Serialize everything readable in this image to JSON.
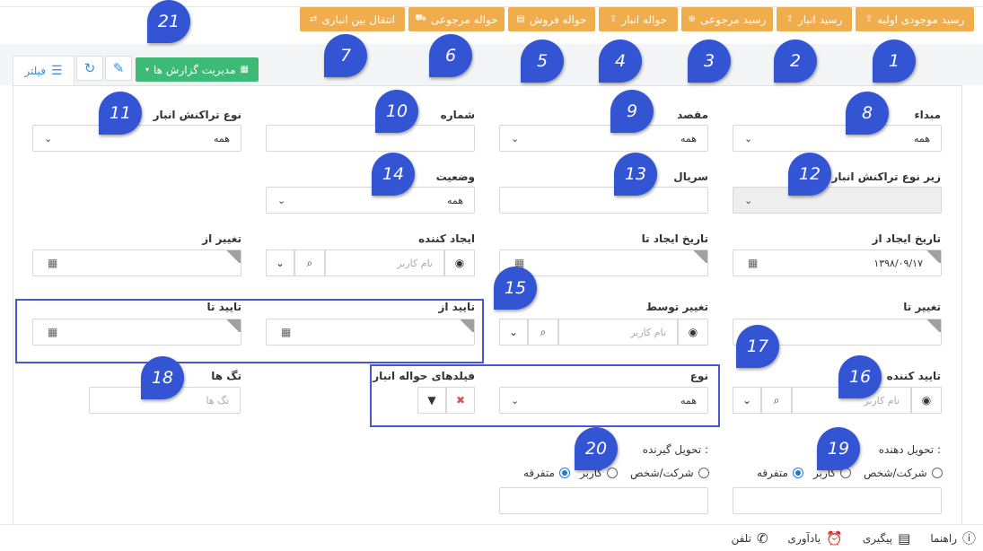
{
  "top_buttons": [
    {
      "label": "رسید موجودی اولیه",
      "icon": "receipt-icon"
    },
    {
      "label": "رسید انبار",
      "icon": "receipt-icon"
    },
    {
      "label": "رسید مرجوعی",
      "icon": "return-icon"
    },
    {
      "label": "حواله انبار",
      "icon": "transfer-icon"
    },
    {
      "label": "حواله فروش",
      "icon": "sale-icon"
    },
    {
      "label": "حواله مرجوعی",
      "icon": "cart-icon"
    },
    {
      "label": "انتقال بین انباری",
      "icon": "move-icon"
    }
  ],
  "toolbar": {
    "report_manage": "مدیریت گزارش ها",
    "filter": "فیلتر"
  },
  "fields": {
    "origin": {
      "label": "مبداء",
      "value": "همه"
    },
    "destination": {
      "label": "مقصد",
      "value": "همه"
    },
    "number": {
      "label": "شماره"
    },
    "transaction_type": {
      "label": "نوع تراکنش انبار",
      "value": "همه"
    },
    "sub_type": {
      "label": "زیر نوع تراکنش انبار"
    },
    "serial": {
      "label": "سریال"
    },
    "status": {
      "label": "وضعیت",
      "value": "همه"
    },
    "created_from": {
      "label": "تاریخ ایجاد از",
      "value": "۱۳۹۸/۰۹/۱۷"
    },
    "created_to": {
      "label": "تاریخ ایجاد تا"
    },
    "creator": {
      "label": "ایجاد کننده",
      "placeholder": "نام کاربر"
    },
    "changed_from": {
      "label": "تغییر از"
    },
    "changed_to": {
      "label": "تغییر تا"
    },
    "changed_by": {
      "label": "تغییر توسط",
      "placeholder": "نام کاربر"
    },
    "approved_from": {
      "label": "تایید از"
    },
    "approved_to": {
      "label": "تایید تا"
    },
    "approver": {
      "label": "تایید کننده",
      "placeholder": "نام کاربر"
    },
    "type": {
      "label": "نوع",
      "value": "همه"
    },
    "transfer_fields": {
      "label": "فیلدهای حواله انبار"
    },
    "tags": {
      "label": "تگ ها",
      "placeholder": "تگ ها"
    },
    "deliverer": {
      "label": "تحویل دهنده :"
    },
    "receiver": {
      "label": "تحویل گیرنده :"
    }
  },
  "radio_options": [
    "شرکت/شخص",
    "کاربر",
    "متفرقه"
  ],
  "markers": [
    "1",
    "2",
    "3",
    "4",
    "5",
    "6",
    "7",
    "8",
    "9",
    "10",
    "11",
    "12",
    "13",
    "14",
    "15",
    "16",
    "17",
    "18",
    "19",
    "20",
    "21"
  ],
  "footer": [
    {
      "label": "تلفن",
      "icon": "phone-icon"
    },
    {
      "label": "یادآوری",
      "icon": "alarm-icon"
    },
    {
      "label": "پیگیری",
      "icon": "clipboard-icon"
    },
    {
      "label": "راهنما",
      "icon": "help-icon"
    }
  ],
  "colors": {
    "orange": "#f0ad4e",
    "green": "#3dbb76",
    "marker": "#3355d4",
    "radio": "#1c7ed6"
  }
}
